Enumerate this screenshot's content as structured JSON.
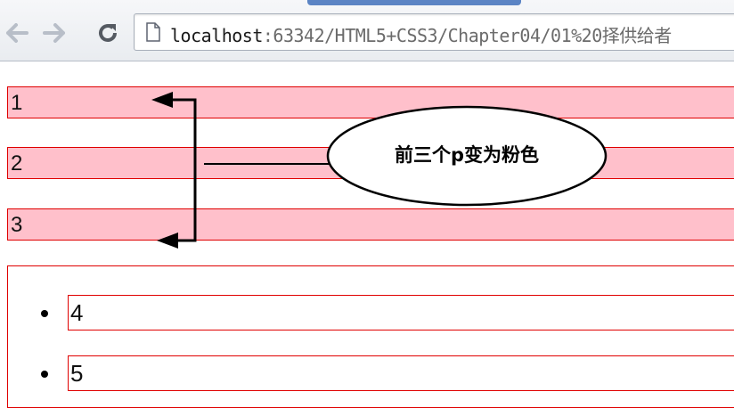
{
  "browser": {
    "url_host": "localhost",
    "url_rest": ":63342/HTML5+CSS3/Chapter04/01%20择供给者",
    "icons": [
      "back-arrow-icon",
      "forward-arrow-icon",
      "reload-icon",
      "page-icon"
    ]
  },
  "paragraphs": [
    "1",
    "2",
    "3"
  ],
  "list_items": [
    "4",
    "5"
  ],
  "annotation": {
    "text": "前三个p变为粉色"
  },
  "colors": {
    "pink_background": "#ffc0cb",
    "outline_red": "#e00000"
  }
}
